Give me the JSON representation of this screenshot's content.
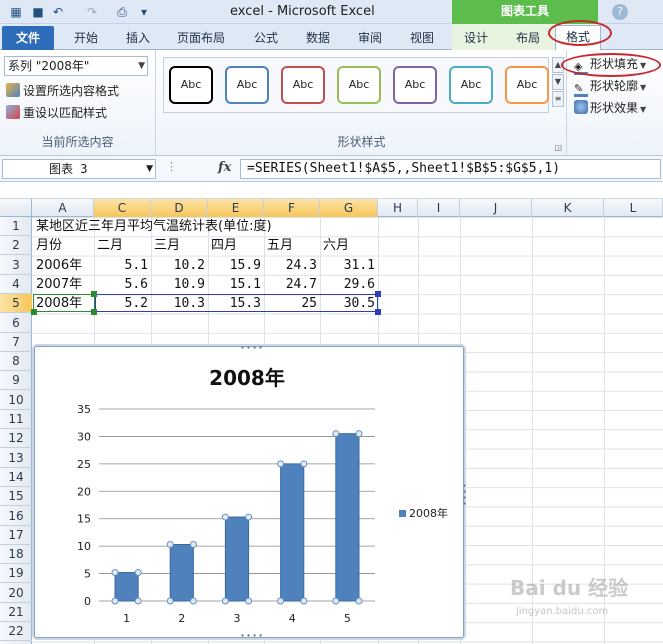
{
  "window": {
    "title": "excel  -  Microsoft Excel",
    "context_tab_group": "图表工具",
    "quick_access": [
      "save-icon",
      "undo-icon",
      "redo-icon",
      "print-preview-icon"
    ]
  },
  "tabs": [
    "文件",
    "开始",
    "插入",
    "页面布局",
    "公式",
    "数据",
    "审阅",
    "视图",
    "设计",
    "布局",
    "格式"
  ],
  "ribbon": {
    "current_selection": {
      "series_selected": "系列 \"2008年\"",
      "format_selection": "设置所选内容格式",
      "reset_style": "重设以匹配样式",
      "group_label": "当前所选内容"
    },
    "shape_styles": {
      "group_label": "形状样式",
      "swatch_text": "Abc",
      "swatch_colors": [
        "#000000",
        "#4f81bd",
        "#c0504d",
        "#9bbb59",
        "#8064a2",
        "#4bacc6",
        "#f79646"
      ],
      "shape_fill": "形状填充",
      "shape_outline": "形状轮廓",
      "shape_effects": "形状效果"
    }
  },
  "formula_bar": {
    "name_box": "图表 3",
    "fx": "fx",
    "formula": "=SERIES(Sheet1!$A$5,,Sheet1!$B$5:$G$5,1)"
  },
  "sheet": {
    "columns": [
      "A",
      "C",
      "D",
      "E",
      "F",
      "G",
      "H",
      "I",
      "J",
      "K",
      "L"
    ],
    "rows": [
      "1",
      "2",
      "3",
      "4",
      "5",
      "6",
      "7",
      "8",
      "9",
      "10",
      "11",
      "12",
      "13",
      "14",
      "15",
      "16",
      "17",
      "18",
      "19",
      "20",
      "21",
      "22"
    ],
    "title_cell": "某地区近三年月平均气温统计表(单位:度)",
    "header_row": [
      "月份",
      "二月",
      "三月",
      "四月",
      "五月",
      "六月"
    ],
    "data_rows": [
      {
        "label": "2006年",
        "values": [
          "5.1",
          "10.2",
          "15.9",
          "24.3",
          "31.1"
        ]
      },
      {
        "label": "2007年",
        "values": [
          "5.6",
          "10.9",
          "15.1",
          "24.7",
          "29.6"
        ]
      },
      {
        "label": "2008年",
        "values": [
          "5.2",
          "10.3",
          "15.3",
          "25",
          "30.5"
        ]
      }
    ]
  },
  "chart_data": {
    "type": "bar",
    "title": "2008年",
    "categories": [
      "1",
      "2",
      "3",
      "4",
      "5"
    ],
    "series": [
      {
        "name": "2008年",
        "values": [
          5.2,
          10.3,
          15.3,
          25,
          30.5
        ],
        "color": "#4f81bd"
      }
    ],
    "ylim": [
      0,
      35
    ],
    "yticks": [
      0,
      5,
      10,
      15,
      20,
      25,
      30,
      35
    ],
    "grid": true,
    "legend": "right"
  },
  "watermark": {
    "text": "Bai du 经验",
    "sub": "jingyan.baidu.com"
  }
}
